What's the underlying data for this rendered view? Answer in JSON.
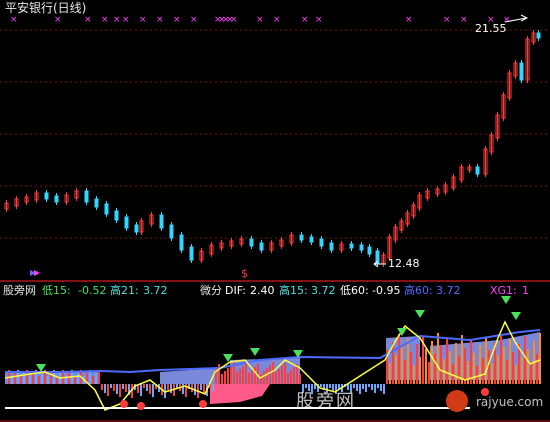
{
  "title": "平安银行(日线)",
  "price_high_label": "21.55",
  "price_low_label": "12.48",
  "indicator_bar": {
    "panel_name": "股旁网",
    "low15_label": "低15:",
    "low15_value": "-0.52",
    "high21_label": "高21:",
    "high21_value": "3.72",
    "diff_name": "微分",
    "dif_label": "DIF:",
    "dif_value": "2.40",
    "high15_label": "高15:",
    "high15_value": "3.72",
    "low60_label": "低60:",
    "low60_value": "-0.95",
    "high60_label": "高60:",
    "high60_value": "3.72",
    "xg1_label": "XG1:",
    "xg1_value": "1"
  },
  "watermark_left": "股旁网",
  "watermark_right": "rajyue.com",
  "colors": {
    "up": "#ff3b3b",
    "down": "#33d6ff",
    "magenta": "#ff40ff",
    "green": "#49e15a",
    "yellow": "#ffff40",
    "blue": "#4d6bff",
    "pink": "#ff5a8a",
    "orange": "#ff8c1a",
    "ma": "#ffffff"
  }
}
